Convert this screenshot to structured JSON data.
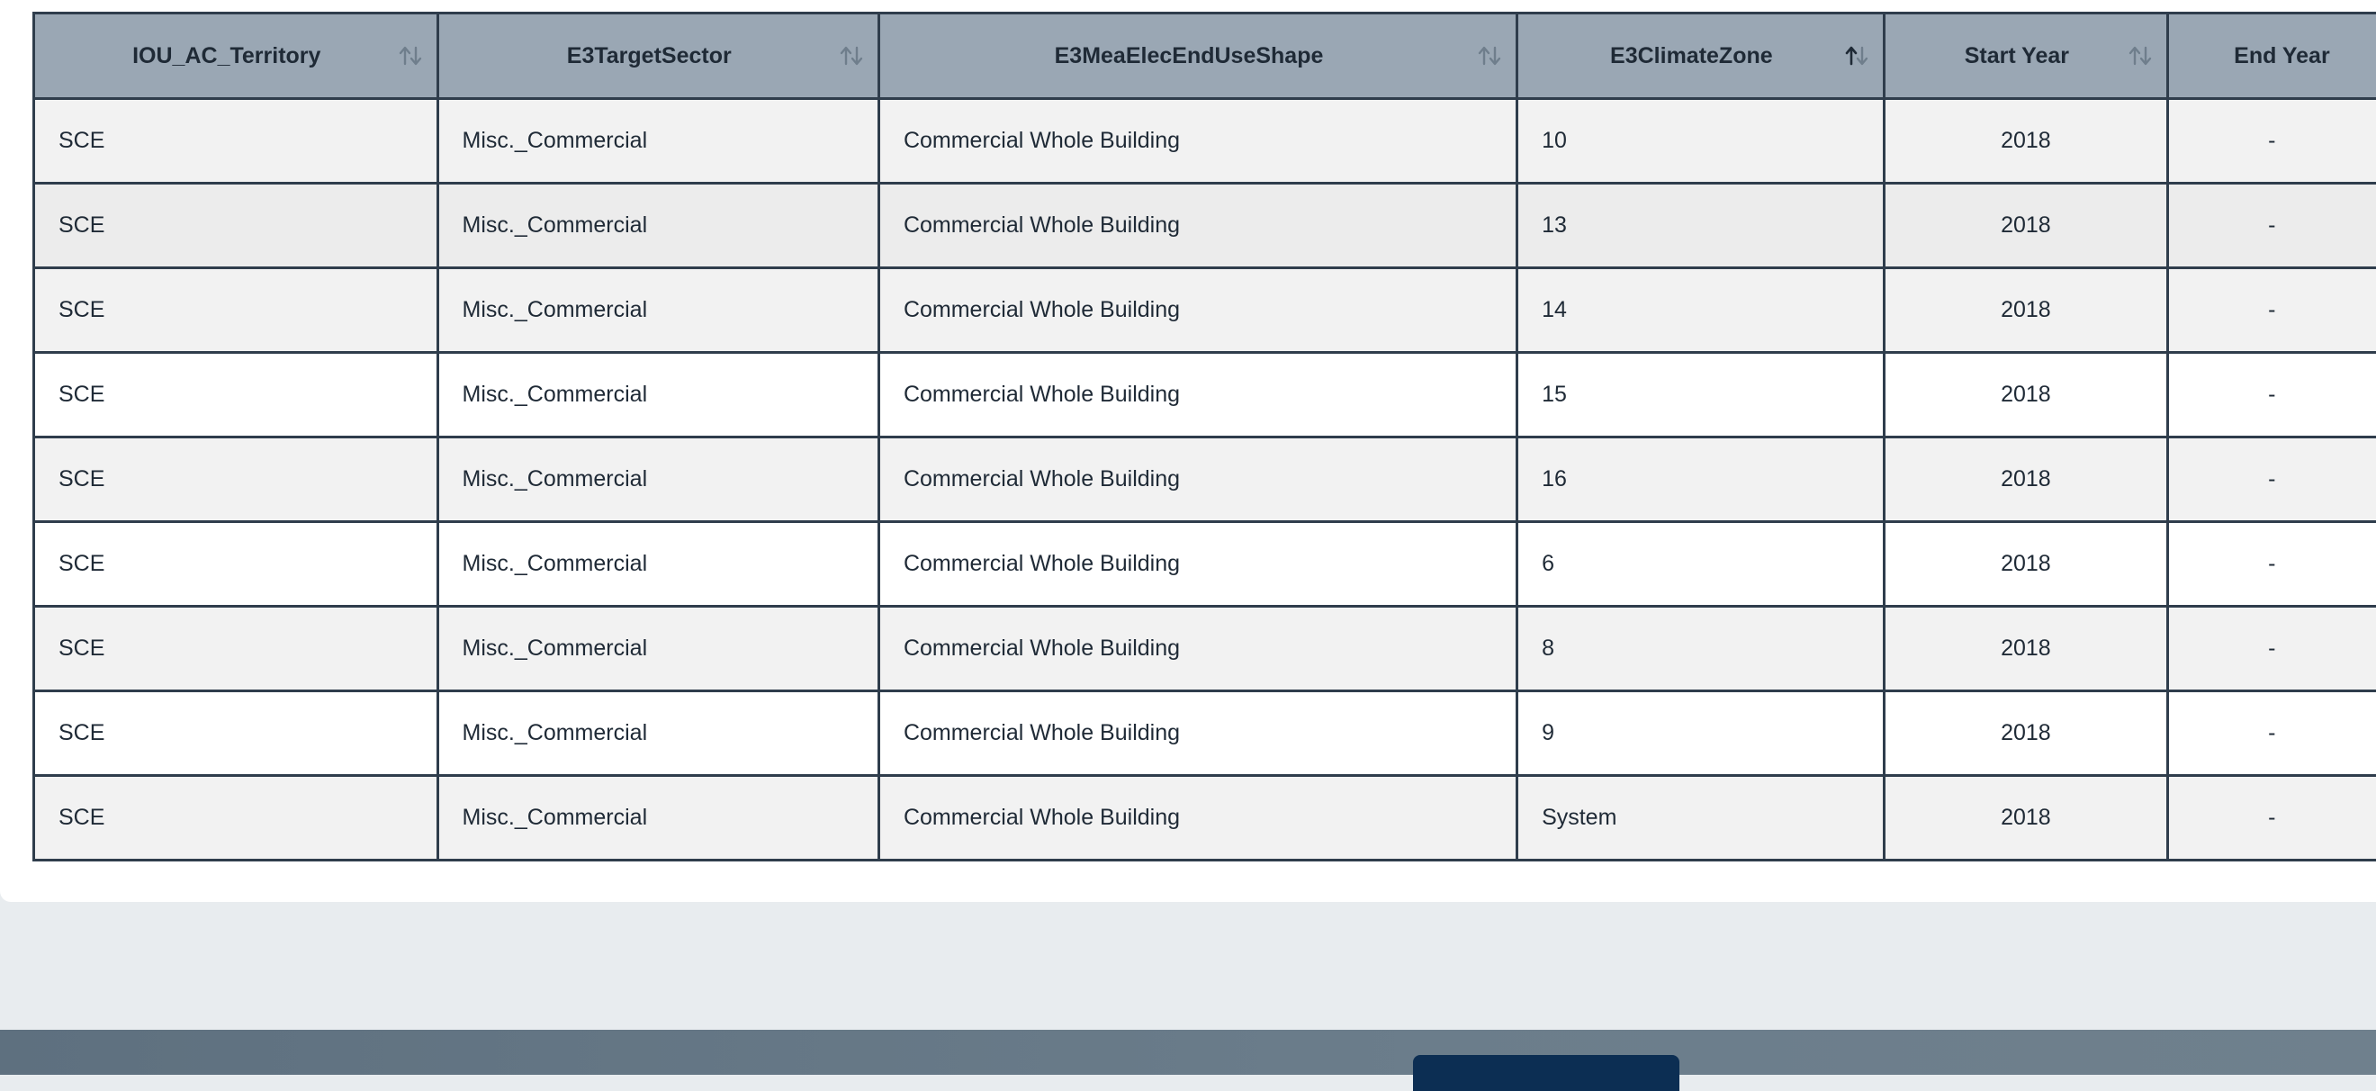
{
  "table": {
    "columns": [
      {
        "label": "IOU_AC_Territory",
        "sort": "none"
      },
      {
        "label": "E3TargetSector",
        "sort": "none"
      },
      {
        "label": "E3MeaElecEndUseShape",
        "sort": "none"
      },
      {
        "label": "E3ClimateZone",
        "sort": "asc"
      },
      {
        "label": "Start Year",
        "sort": "none"
      },
      {
        "label": "End Year",
        "sort": "none"
      }
    ],
    "rows": [
      [
        "SCE",
        "Misc._Commercial",
        "Commercial Whole Building",
        "10",
        "2018",
        "-"
      ],
      [
        "SCE",
        "Misc._Commercial",
        "Commercial Whole Building",
        "13",
        "2018",
        "-"
      ],
      [
        "SCE",
        "Misc._Commercial",
        "Commercial Whole Building",
        "14",
        "2018",
        "-"
      ],
      [
        "SCE",
        "Misc._Commercial",
        "Commercial Whole Building",
        "15",
        "2018",
        "-"
      ],
      [
        "SCE",
        "Misc._Commercial",
        "Commercial Whole Building",
        "16",
        "2018",
        "-"
      ],
      [
        "SCE",
        "Misc._Commercial",
        "Commercial Whole Building",
        "6",
        "2018",
        "-"
      ],
      [
        "SCE",
        "Misc._Commercial",
        "Commercial Whole Building",
        "8",
        "2018",
        "-"
      ],
      [
        "SCE",
        "Misc._Commercial",
        "Commercial Whole Building",
        "9",
        "2018",
        "-"
      ],
      [
        "SCE",
        "Misc._Commercial",
        "Commercial Whole Building",
        "System",
        "2018",
        "-"
      ]
    ]
  },
  "icons": {
    "sort_none": "sort-icon",
    "sort_asc": "sort-asc-icon"
  },
  "colors": {
    "header_bg": "#9aa7b4",
    "border": "#2f3d4c",
    "footer_button": "#0c2e53"
  }
}
